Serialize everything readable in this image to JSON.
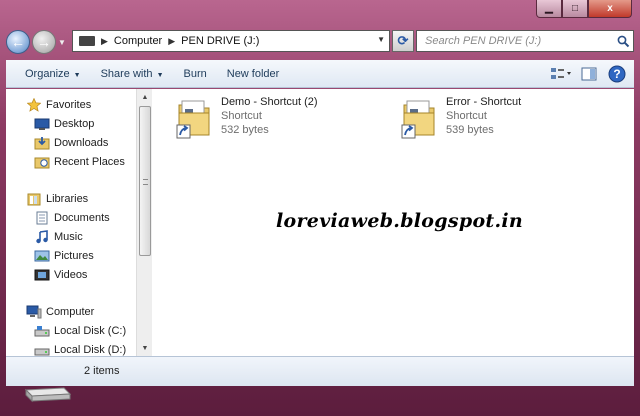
{
  "window": {
    "caption_buttons": {
      "minimize": "▁",
      "maximize": "□",
      "close": "x"
    }
  },
  "address": {
    "crumbs": [
      "Computer",
      "PEN DRIVE (J:)"
    ],
    "search_placeholder": "Search PEN DRIVE (J:)"
  },
  "toolbar": {
    "organize": "Organize",
    "share_with": "Share with",
    "burn": "Burn",
    "new_folder": "New folder"
  },
  "navpane": {
    "favorites": "Favorites",
    "desktop": "Desktop",
    "downloads": "Downloads",
    "recent_places": "Recent Places",
    "libraries": "Libraries",
    "documents": "Documents",
    "music": "Music",
    "pictures": "Pictures",
    "videos": "Videos",
    "computer": "Computer",
    "local_c": "Local Disk (C:)",
    "local_d": "Local Disk (D:)"
  },
  "files": [
    {
      "name": "Demo - Shortcut (2)",
      "type": "Shortcut",
      "size": "532 bytes"
    },
    {
      "name": "Error - Shortcut",
      "type": "Shortcut",
      "size": "539 bytes"
    }
  ],
  "watermark": "loreviaweb.blogspot.in",
  "details": {
    "count": "2 items"
  },
  "colors": {
    "accent": "#2b5aa5",
    "frame": "#8d3b63"
  }
}
